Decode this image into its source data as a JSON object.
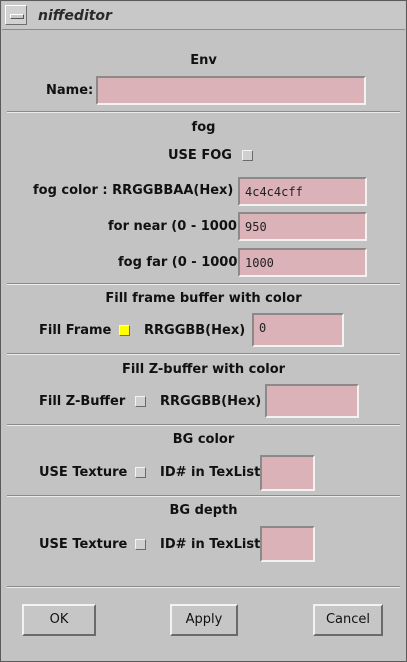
{
  "window": {
    "title": "niffeditor"
  },
  "env": {
    "section_label": "Env",
    "name_label": "Name:",
    "name_value": ""
  },
  "fog": {
    "section_label": "fog",
    "use_fog_label": "USE FOG",
    "use_fog_checked": false,
    "color_label": "fog color : RRGGBBAA(Hex)",
    "color_value": "4c4c4cff",
    "near_label": "for near (0 - 1000)",
    "near_value": "950",
    "far_label": "fog far (0 - 1000)",
    "far_value": "1000"
  },
  "fill_frame": {
    "section_label": "Fill frame buffer with color",
    "toggle_label": "Fill Frame",
    "toggle_checked": true,
    "color_label": "RRGGBB(Hex)",
    "color_value": "0"
  },
  "fill_z": {
    "section_label": "Fill Z-buffer with color",
    "toggle_label": "Fill Z-Buffer",
    "toggle_checked": false,
    "color_label": "RRGGBB(Hex)",
    "color_value": ""
  },
  "bg_color": {
    "section_label": "BG color",
    "texture_label": "USE Texture",
    "texture_checked": false,
    "id_label": "ID# in TexList",
    "id_value": ""
  },
  "bg_depth": {
    "section_label": "BG depth",
    "texture_label": "USE Texture",
    "texture_checked": false,
    "id_label": "ID# in TexList",
    "id_value": ""
  },
  "buttons": {
    "ok": "OK",
    "apply": "Apply",
    "cancel": "Cancel"
  },
  "colors": {
    "field_bg": "#dbb2b8",
    "checked": "#ffff00",
    "window_bg": "#c3c3c3"
  }
}
